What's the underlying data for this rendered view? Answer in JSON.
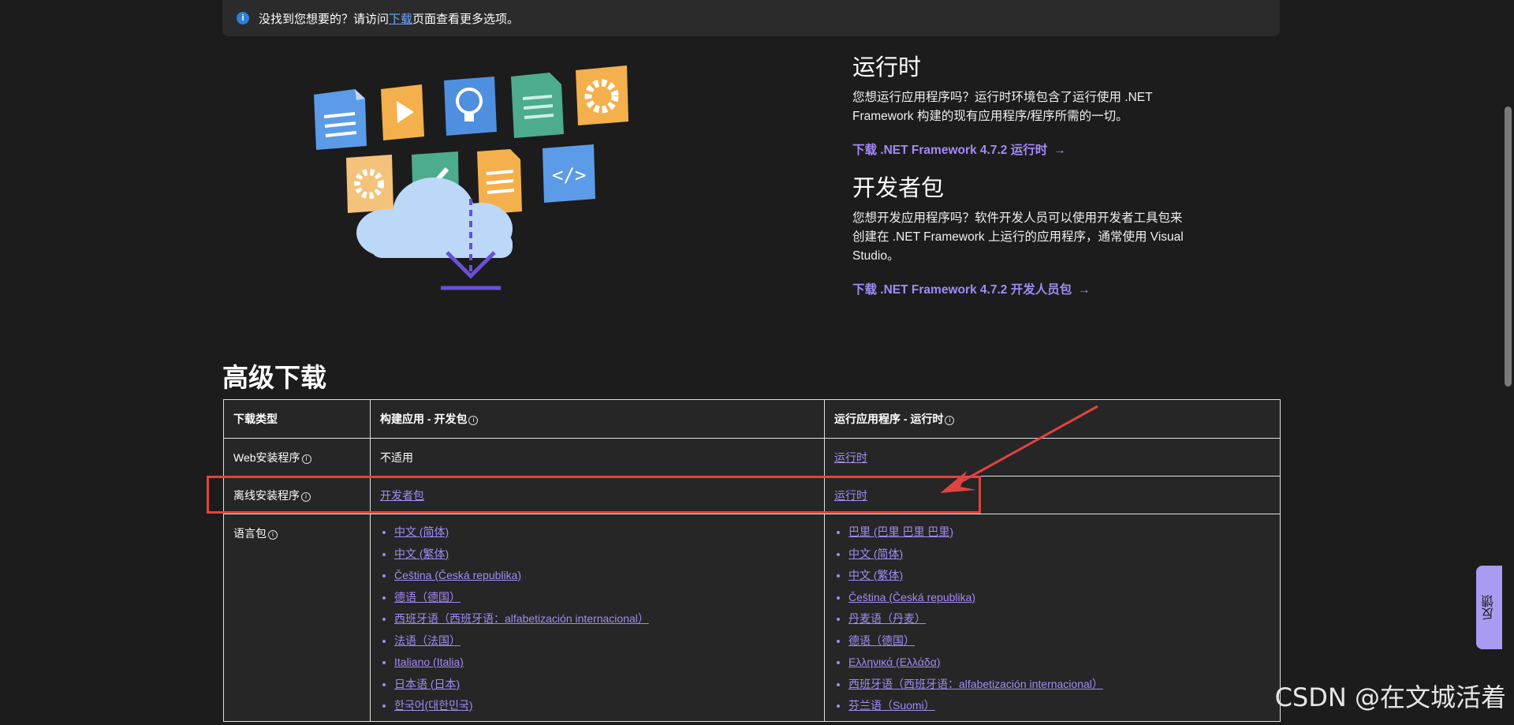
{
  "banner": {
    "prefix": "没找到您想要的？请访问",
    "link": "下载",
    "suffix": "页面查看更多选项。"
  },
  "runtime": {
    "title": "运行时",
    "desc": "您想运行应用程序吗？运行时环境包含了运行使用 .NET Framework 构建的现有应用程序/程序所需的一切。",
    "link": "下载 .NET Framework 4.7.2 运行时"
  },
  "devpack": {
    "title": "开发者包",
    "desc": "您想开发应用程序吗？软件开发人员可以使用开发者工具包来创建在 .NET Framework 上运行的应用程序，通常使用 Visual Studio。",
    "link": "下载 .NET Framework 4.7.2 开发人员包"
  },
  "advanced": {
    "title": "高级下载",
    "headers": [
      "下载类型",
      "构建应用 - 开发包",
      "运行应用程序 - 运行时"
    ],
    "rows": {
      "web": {
        "type": "Web安装程序",
        "build": "不适用",
        "run": "运行时"
      },
      "offline": {
        "type": "离线安装程序",
        "build": "开发者包",
        "run": "运行时"
      },
      "lang": {
        "type": "语言包"
      }
    },
    "build_langs": [
      "中文 (简体)",
      "中文 (繁体)",
      "Čeština (Česká republika)",
      "德语（德国）",
      "西班牙语（西班牙语：alfabetización internacional）",
      "法语（法国）",
      "Italiano (Italia)",
      "日本语 (日本)",
      "한국어(대한민국)"
    ],
    "run_langs": [
      "巴里 (巴里 巴里 巴里)",
      "中文 (简体)",
      "中文 (繁体)",
      "Čeština (Česká republika)",
      "丹麦语（丹麦）",
      "德语（德国）",
      "Ελληνικά (Ελλάδα)",
      "西班牙语（西班牙语：alfabetización internacional）",
      "芬兰语（Suomi）"
    ]
  },
  "feedback": "反馈",
  "watermark": "CSDN @在文城活着",
  "colors": {
    "background": "#1c1c1c",
    "link": "#a48af5",
    "annotation": "#e0433f"
  }
}
